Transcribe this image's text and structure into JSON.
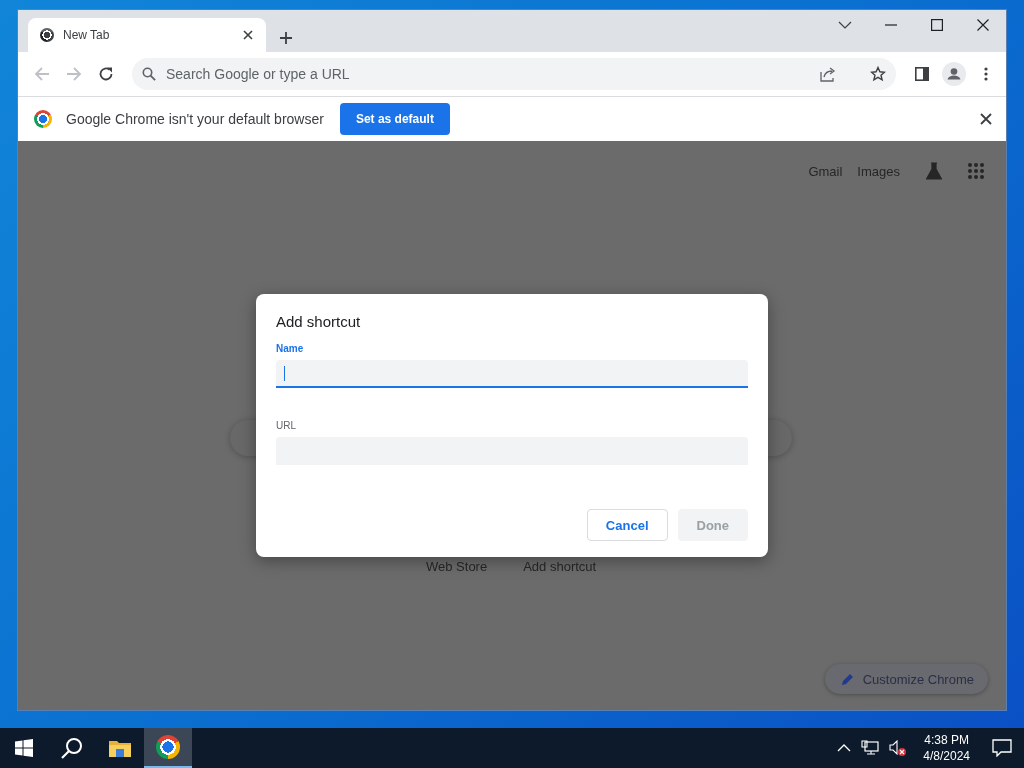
{
  "browser": {
    "tabs": [
      {
        "title": "New Tab",
        "selected": true
      }
    ],
    "omnibox": {
      "placeholder": "Search Google or type a URL"
    },
    "infobar": {
      "message": "Google Chrome isn't your default browser",
      "button": "Set as default"
    }
  },
  "page": {
    "header_links": [
      "Gmail",
      "Images"
    ],
    "shortcuts": [
      "Web Store",
      "Add shortcut"
    ],
    "customize_button": "Customize Chrome"
  },
  "dialog": {
    "title": "Add shortcut",
    "fields": [
      {
        "label": "Name",
        "focused": true
      },
      {
        "label": "URL",
        "focused": false
      }
    ],
    "buttons": [
      {
        "label": "Cancel",
        "disabled": false
      },
      {
        "label": "Done",
        "disabled": true
      }
    ]
  },
  "taskbar": {
    "apps": [
      {
        "kind": "files",
        "selected": false
      },
      {
        "kind": "chrome",
        "selected": true
      }
    ],
    "clock": {
      "time": "4:38 PM",
      "date": "4/8/2024"
    }
  }
}
